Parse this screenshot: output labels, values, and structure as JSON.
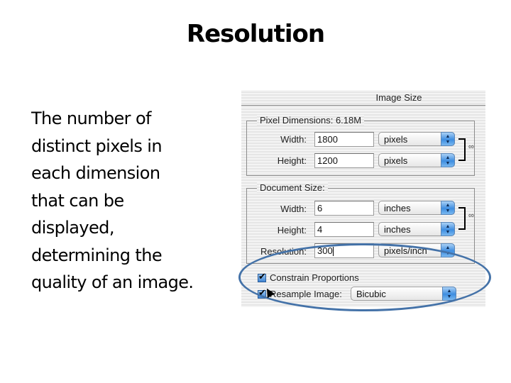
{
  "slide": {
    "title": "Resolution",
    "body_lines": [
      "The number of",
      "distinct pixels in",
      "each dimension",
      "that can be",
      "displayed,",
      "determining the",
      "quality of an image."
    ]
  },
  "dialog": {
    "title": "Image Size",
    "pixel_dimensions": {
      "label": "Pixel Dimensions:",
      "value": "6.18M",
      "width_label": "Width:",
      "width_value": "1800",
      "width_unit": "pixels",
      "height_label": "Height:",
      "height_value": "1200",
      "height_unit": "pixels"
    },
    "document_size": {
      "label": "Document Size:",
      "width_label": "Width:",
      "width_value": "6",
      "width_unit": "inches",
      "height_label": "Height:",
      "height_value": "4",
      "height_unit": "inches",
      "resolution_label": "Resolution:",
      "resolution_value": "300",
      "resolution_unit": "pixels/inch"
    },
    "constrain_proportions": {
      "label": "Constrain Proportions",
      "checked": true
    },
    "resample_image": {
      "label": "Resample Image:",
      "checked": true,
      "method": "Bicubic"
    },
    "icons": {
      "select_arrows": "▲▼",
      "chain_link": "link-icon"
    },
    "colors": {
      "highlight_ellipse": "#4472a8",
      "select_arrow_blue": "#3e8de0"
    }
  }
}
